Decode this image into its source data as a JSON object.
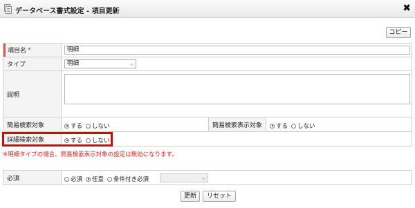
{
  "window": {
    "title": "データベース書式設定 - 項目更新",
    "close_symbol": "✖"
  },
  "toolbar": {
    "copy_label": "コピー"
  },
  "form": {
    "item_name": {
      "label": "項目名",
      "required_mark": "*",
      "value": "明細"
    },
    "type": {
      "label": "タイプ",
      "selected": "明細"
    },
    "description": {
      "label": "説明",
      "value": ""
    },
    "simple_search": {
      "label": "簡易検索対象",
      "options": [
        "する",
        "しない"
      ],
      "selected_index": 0
    },
    "simple_search_display": {
      "label": "簡易検索表示対象",
      "options": [
        "する",
        "しない"
      ],
      "selected_index": 0
    },
    "detail_search": {
      "label": "詳細検索対象",
      "options": [
        "する",
        "しない"
      ],
      "selected_index": 0
    },
    "warning": "※明細タイプの場合、簡易検索表示対象の設定は無効になります。",
    "required": {
      "label": "必須",
      "options": [
        "必須",
        "任意",
        "条件付き必須"
      ],
      "selected_index": 1,
      "condition_select_value": ""
    }
  },
  "actions": {
    "update_label": "更新",
    "reset_label": "リセット"
  },
  "colors": {
    "highlight": "#e00000",
    "warning": "#e0231b",
    "required_marker": "#d9534f"
  }
}
